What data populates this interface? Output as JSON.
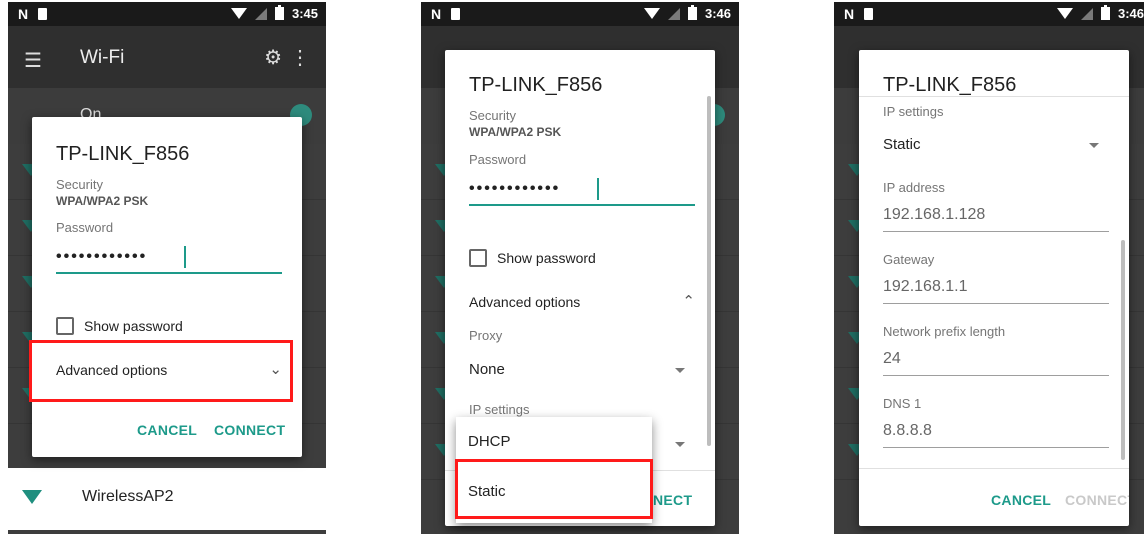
{
  "status_bar": {
    "screen1_time": "3:45",
    "screen2_time": "3:46",
    "screen3_time": "3:46"
  },
  "background": {
    "app_title": "Wi-Fi",
    "on_label": "On",
    "network_name": "WirelessAP2"
  },
  "dialog": {
    "title": "TP-LINK_F856",
    "security_label": "Security",
    "security_value": "WPA/WPA2 PSK",
    "password_label": "Password",
    "password_value": "••••••••••••",
    "show_password": "Show password",
    "advanced_options": "Advanced options",
    "cancel": "CANCEL",
    "connect": "CONNECT"
  },
  "advanced": {
    "proxy_label": "Proxy",
    "proxy_value": "None",
    "ip_settings_label": "IP settings",
    "ip_options": [
      "DHCP",
      "Static"
    ],
    "connect_partial": "NECT"
  },
  "static_settings": {
    "ip_settings_label": "IP settings",
    "ip_settings_value": "Static",
    "ip_address_label": "IP address",
    "ip_address_value": "192.168.1.128",
    "gateway_label": "Gateway",
    "gateway_value": "192.168.1.1",
    "prefix_label": "Network prefix length",
    "prefix_value": "24",
    "dns1_label": "DNS 1",
    "dns1_value": "8.8.8.8"
  },
  "colors": {
    "accent": "#1d9a8a",
    "highlight": "#ff1a1a"
  }
}
